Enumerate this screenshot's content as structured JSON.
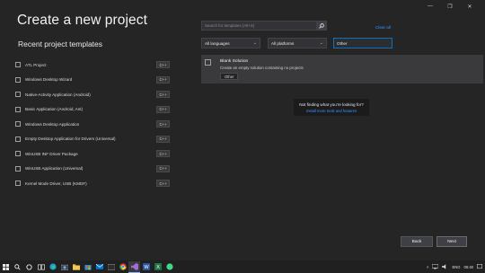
{
  "window": {
    "controls": [
      "minimize",
      "restore",
      "close"
    ]
  },
  "header": {
    "title": "Create a new project"
  },
  "recent": {
    "heading": "Recent project templates",
    "items": [
      {
        "label": "ATL Project",
        "lang": "C++"
      },
      {
        "label": "Windows Desktop Wizard",
        "lang": "C++"
      },
      {
        "label": "Native-Activity Application (Android)",
        "lang": "C++"
      },
      {
        "label": "Basic Application (Android, Ant)",
        "lang": "C++"
      },
      {
        "label": "Windows Desktop Application",
        "lang": "C++"
      },
      {
        "label": "Empty Desktop Application for Drivers (Universal)",
        "lang": "C++"
      },
      {
        "label": "WinUSB INF Driver Package",
        "lang": "C++"
      },
      {
        "label": "WinUSB Application (Universal)",
        "lang": "C++"
      },
      {
        "label": "Kernel Mode Driver, USB (KMDF)",
        "lang": "C++"
      }
    ]
  },
  "search": {
    "placeholder": "Search for templates (Alt+S)",
    "clear_all": "Clear all"
  },
  "filters": {
    "language": "All languages",
    "platform": "All platforms",
    "project_type": "Other"
  },
  "template": {
    "name": "Blank Solution",
    "description": "Create an empty solution containing no projects",
    "tag": "Other"
  },
  "not_finding": {
    "title": "Not finding what you're looking for?",
    "link": "Install more tools and features"
  },
  "buttons": {
    "back": "Back",
    "next": "Next"
  },
  "taskbar": {
    "language": "ENG",
    "time": "06:40"
  }
}
